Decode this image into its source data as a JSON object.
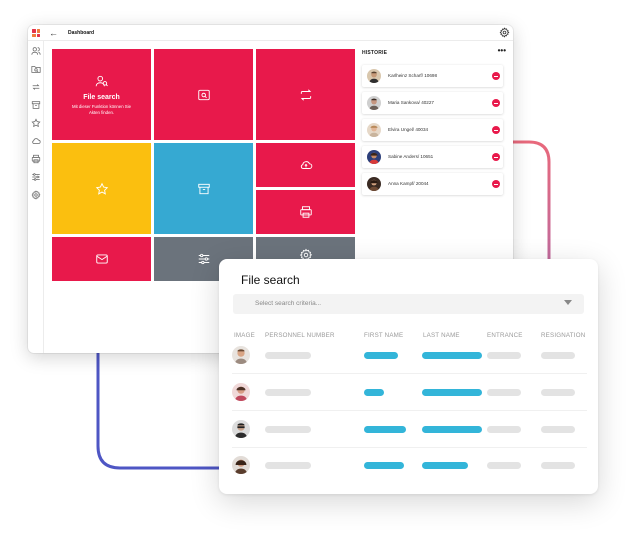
{
  "dashboard": {
    "breadcrumb": "Dashboard",
    "back_glyph": "←",
    "tiles": {
      "file_search": {
        "title": "File search",
        "description": "Mit dieser Funktion können Sie Akten finden."
      }
    },
    "history": {
      "title": "HISTORIE",
      "more": "•••",
      "items": [
        {
          "name": "Karlheinz Scharf/ 10698"
        },
        {
          "name": "Maria Sankova/ 40227"
        },
        {
          "name": "Elvira Ungel/ 40034"
        },
        {
          "name": "Sabine Anders/ 10651"
        },
        {
          "name": "Anna Kampf/ 20044"
        }
      ]
    }
  },
  "file_search": {
    "title": "File search",
    "select_placeholder": "Select search criteria...",
    "columns": [
      "IMAGE",
      "PERSONNEL NUMBER",
      "FIRST NAME",
      "LAST NAME",
      "ENTRANCE",
      "RESIGNATION"
    ]
  },
  "colors": {
    "red": "#e8194b",
    "yellow": "#fbbf0f",
    "blue": "#36a9d2",
    "grey": "#6b737c",
    "connector_red": "#e8697c",
    "connector_blue": "#4e56c4",
    "bar_blue": "#33b5d9"
  }
}
